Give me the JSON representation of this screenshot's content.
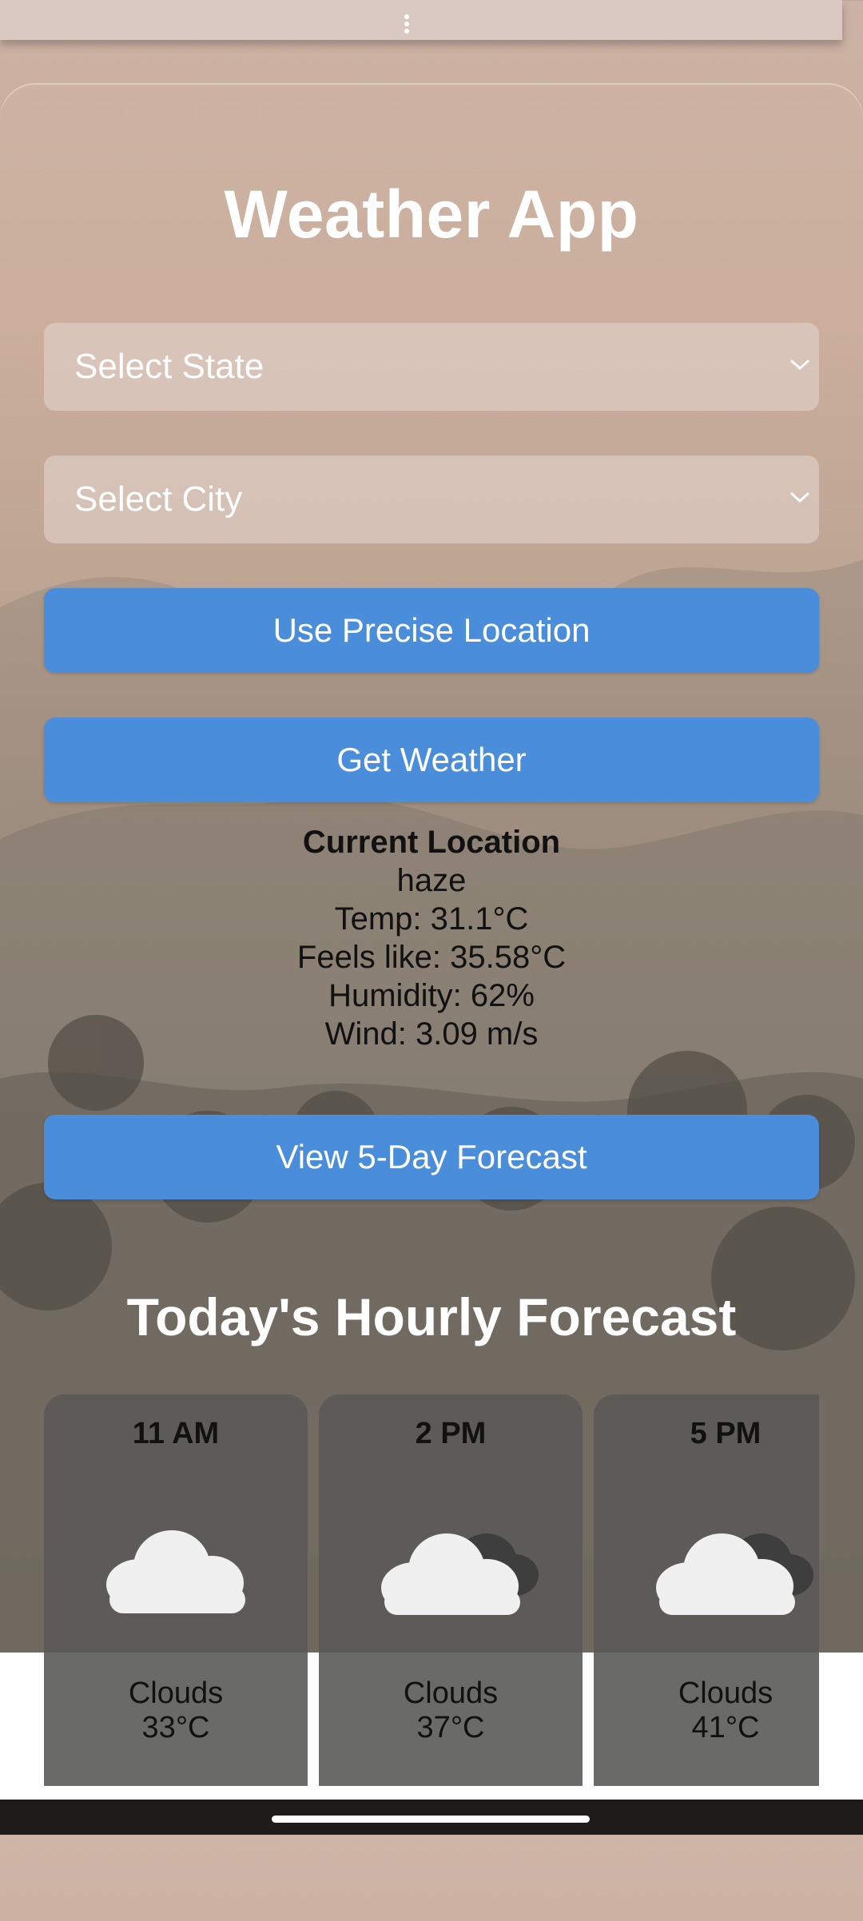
{
  "app": {
    "title": "Weather App"
  },
  "controls": {
    "state_placeholder": "Select State",
    "city_placeholder": "Select City",
    "precise_location_label": "Use Precise Location",
    "get_weather_label": "Get Weather",
    "five_day_label": "View 5-Day Forecast"
  },
  "current": {
    "location": "Current Location",
    "condition": "haze",
    "temp": "Temp: 31.1°C",
    "feels_like": "Feels like: 35.58°C",
    "humidity": "Humidity: 62%",
    "wind": "Wind: 3.09 m/s"
  },
  "hourly": {
    "heading": "Today's Hourly Forecast",
    "items": [
      {
        "time": "11 AM",
        "icon": "cloud-icon",
        "desc": "Clouds",
        "temp": "33°C"
      },
      {
        "time": "2 PM",
        "icon": "cloud-dark-icon",
        "desc": "Clouds",
        "temp": "37°C"
      },
      {
        "time": "5 PM",
        "icon": "cloud-dark-icon",
        "desc": "Clouds",
        "temp": "41°C"
      }
    ]
  },
  "colors": {
    "button": "#4a8edb",
    "title": "#ffffff"
  }
}
